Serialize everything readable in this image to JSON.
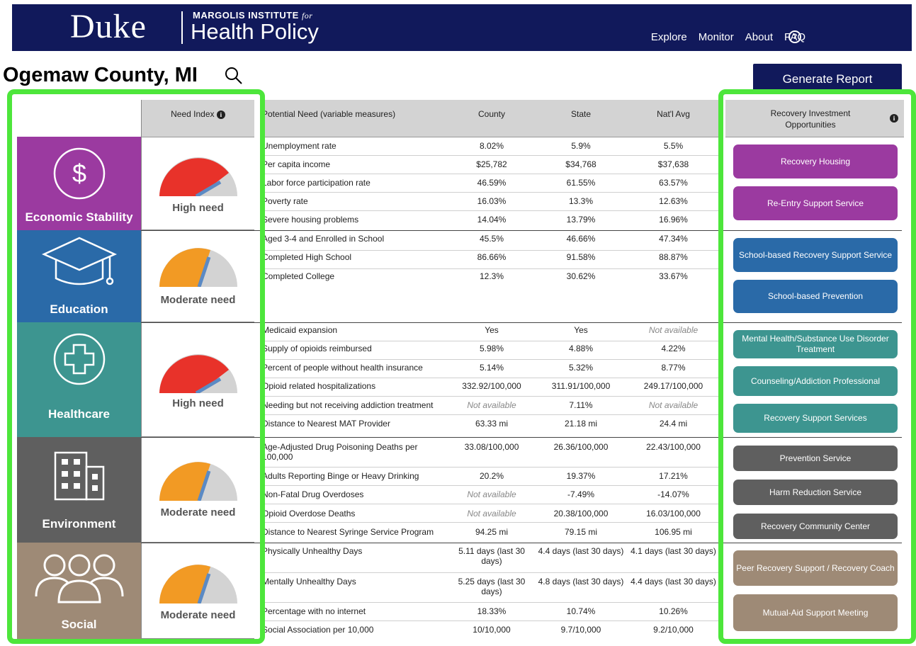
{
  "header": {
    "logo_duke": "Duke",
    "logo_institute": "MARGOLIS INSTITUTE",
    "logo_for": "for",
    "logo_health_policy": "Health Policy",
    "nav": [
      "Explore",
      "Monitor",
      "About",
      "FAQ"
    ],
    "faq_help_glyph": "?"
  },
  "page": {
    "county_title": "Ogemaw County, MI",
    "generate_report": "Generate Report"
  },
  "colors": {
    "header_bg": "#11195b",
    "economic": "#9b3aa0",
    "education": "#2a6aa8",
    "healthcare": "#3d9590",
    "environment": "#5f5f5f",
    "social": "#9e8a76",
    "gauge_high": "#e8322a",
    "gauge_moderate": "#f29a24",
    "highlight": "#4de63b"
  },
  "need_header": "Need Index",
  "categories": [
    {
      "name": "Economic Stability",
      "icon": "dollar-icon",
      "need": "High need",
      "level": "high"
    },
    {
      "name": "Education",
      "icon": "graduation-cap-icon",
      "need": "Moderate need",
      "level": "moderate"
    },
    {
      "name": "Healthcare",
      "icon": "medical-cross-icon",
      "need": "High need",
      "level": "high"
    },
    {
      "name": "Environment",
      "icon": "buildings-icon",
      "need": "Moderate need",
      "level": "moderate"
    },
    {
      "name": "Social",
      "icon": "people-icon",
      "need": "Moderate need",
      "level": "moderate"
    }
  ],
  "table": {
    "headers": [
      "Potential Need (variable measures)",
      "County",
      "State",
      "Nat'l Avg"
    ],
    "rows": [
      [
        "Unemployment rate",
        "8.02%",
        "5.9%",
        "5.5%"
      ],
      [
        "Per capita income",
        "$25,782",
        "$34,768",
        "$37,638"
      ],
      [
        "Labor force participation rate",
        "46.59%",
        "61.55%",
        "63.57%"
      ],
      [
        "Poverty rate",
        "16.03%",
        "13.3%",
        "12.63%"
      ],
      [
        "Severe housing problems",
        "14.04%",
        "13.79%",
        "16.96%"
      ],
      [
        "Aged 3-4 and Enrolled in School",
        "45.5%",
        "46.66%",
        "47.34%"
      ],
      [
        "Completed High School",
        "86.66%",
        "91.58%",
        "88.87%"
      ],
      [
        "Completed College",
        "12.3%",
        "30.62%",
        "33.67%"
      ],
      [
        "Medicaid expansion",
        "Yes",
        "Yes",
        "Not available"
      ],
      [
        "Supply of opioids reimbursed",
        "5.98%",
        "4.88%",
        "4.22%"
      ],
      [
        "Percent of people without health insurance",
        "5.14%",
        "5.32%",
        "8.77%"
      ],
      [
        "Opioid related hospitalizations",
        "332.92/100,000",
        "311.91/100,000",
        "249.17/100,000"
      ],
      [
        "Needing but not receiving addiction treatment",
        "Not available",
        "7.11%",
        "Not available"
      ],
      [
        "Distance to Nearest MAT Provider",
        "63.33 mi",
        "21.18 mi",
        "24.4 mi"
      ],
      [
        "Age-Adjusted Drug Poisoning Deaths per 100,000",
        "33.08/100,000",
        "26.36/100,000",
        "22.43/100,000"
      ],
      [
        "Adults Reporting Binge or Heavy Drinking",
        "20.2%",
        "19.37%",
        "17.21%"
      ],
      [
        "Non-Fatal Drug Overdoses",
        "Not available",
        "-7.49%",
        "-14.07%"
      ],
      [
        "Opioid Overdose Deaths",
        "Not available",
        "20.38/100,000",
        "16.03/100,000"
      ],
      [
        "Distance to Nearest Syringe Service Program",
        "94.25 mi",
        "79.15 mi",
        "106.95 mi"
      ],
      [
        "Physically Unhealthy Days",
        "5.11 days (last 30 days)",
        "4.4 days (last 30 days)",
        "4.1 days (last 30 days)"
      ],
      [
        "Mentally Unhealthy Days",
        "5.25 days (last 30 days)",
        "4.8 days (last 30 days)",
        "4.4 days (last 30 days)"
      ],
      [
        "Percentage with no internet",
        "18.33%",
        "10.74%",
        "10.26%"
      ],
      [
        "Social Association per 10,000",
        "10/10,000",
        "9.7/10,000",
        "9.2/10,000"
      ]
    ]
  },
  "recovery": {
    "header": "Recovery Investment Opportunities",
    "buttons": [
      "Recovery Housing",
      "Re-Entry Support Service",
      "School-based Recovery Support Service",
      "School-based Prevention",
      "Mental Health/Substance Use Disorder Treatment",
      "Counseling/Addiction Professional",
      "Recovery Support Services",
      "Prevention Service",
      "Harm Reduction Service",
      "Recovery Community Center",
      "Peer Recovery Support / Recovery Coach",
      "Mutual-Aid Support Meeting"
    ]
  }
}
